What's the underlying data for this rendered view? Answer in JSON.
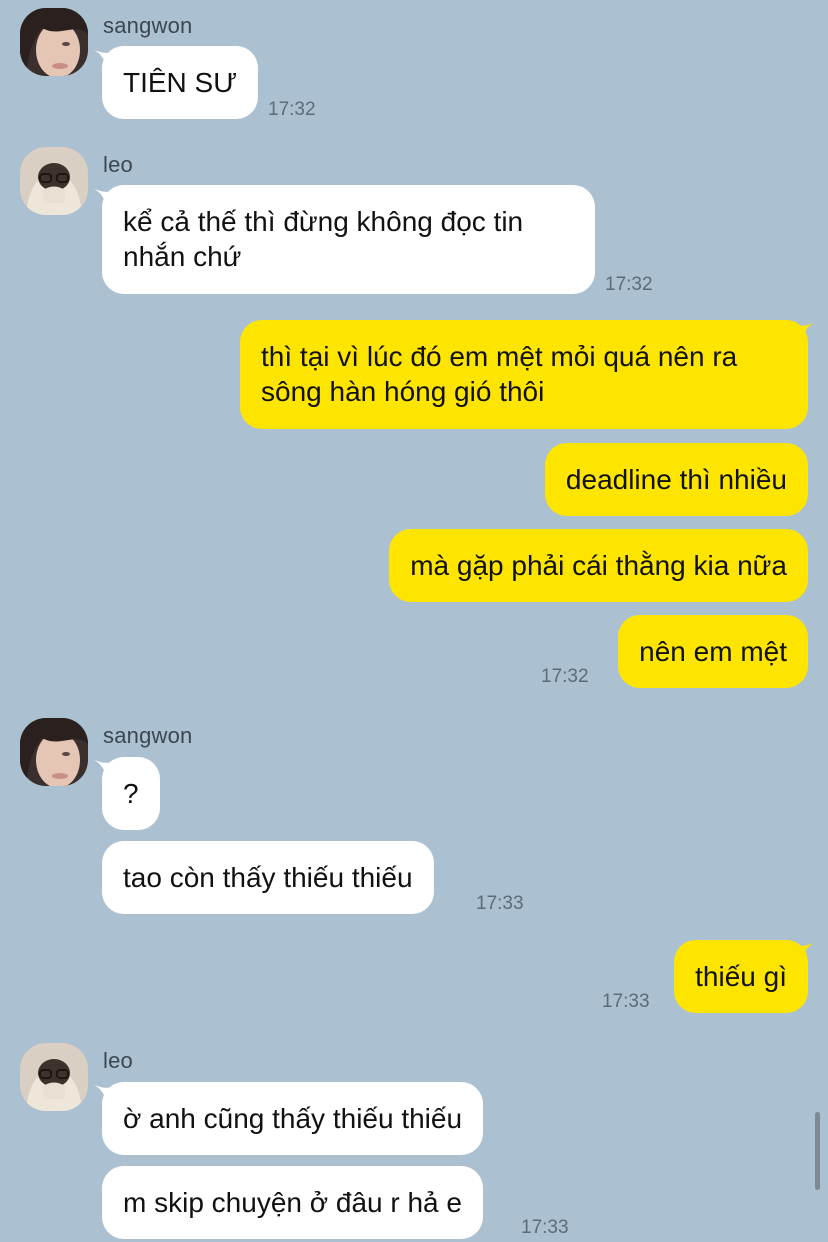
{
  "messages": [
    {
      "sender": "sangwon",
      "text": "TIÊN SƯ",
      "time": "17:32"
    },
    {
      "sender": "leo",
      "text": "kể cả thế thì đừng không đọc tin nhắn chứ",
      "time": "17:32"
    },
    {
      "sender": "me",
      "text": "thì tại vì lúc đó em mệt mỏi quá nên ra sông hàn hóng gió thôi"
    },
    {
      "sender": "me",
      "text": "deadline thì nhiều"
    },
    {
      "sender": "me",
      "text": "mà gặp phải cái thằng kia nữa"
    },
    {
      "sender": "me",
      "text": "nên em mệt",
      "time": "17:32"
    },
    {
      "sender": "sangwon",
      "text": "?"
    },
    {
      "sender": "sangwon",
      "text": "tao còn thấy thiếu thiếu",
      "time": "17:33"
    },
    {
      "sender": "me",
      "text": "thiếu gì",
      "time": "17:33"
    },
    {
      "sender": "leo",
      "text": "ờ anh cũng thấy thiếu thiếu"
    },
    {
      "sender": "leo",
      "text": "m skip chuyện ở đâu r hả e",
      "time": "17:33"
    }
  ],
  "colors": {
    "background": "#abc1d1",
    "incoming_bubble": "#ffffff",
    "outgoing_bubble": "#fee500"
  }
}
